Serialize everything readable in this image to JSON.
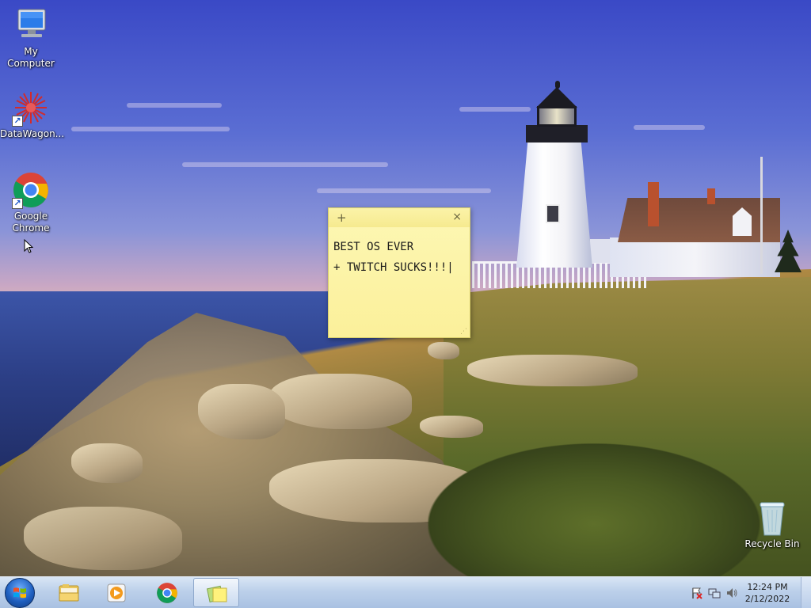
{
  "desktop": {
    "icons": [
      {
        "label": "My Computer",
        "icon": "computer-icon"
      },
      {
        "label": "DataWagon...",
        "icon": "datawagon-icon"
      },
      {
        "label": "Google Chrome",
        "icon": "chrome-icon"
      },
      {
        "label": "Recycle Bin",
        "icon": "recycle-bin-icon"
      }
    ],
    "wallpaper": "lighthouse-coast"
  },
  "sticky_note": {
    "add_glyph": "+",
    "close_glyph": "×",
    "text": "BEST OS EVER\n+ TWITCH SUCKS!!!|"
  },
  "taskbar": {
    "pinned": [
      {
        "name": "windows-explorer",
        "icon": "folder-icon"
      },
      {
        "name": "windows-media-player",
        "icon": "media-player-icon"
      },
      {
        "name": "google-chrome",
        "icon": "chrome-icon"
      },
      {
        "name": "sticky-notes",
        "icon": "sticky-notes-icon",
        "active": true
      }
    ],
    "tray": {
      "icons": [
        "action-center-flag-icon",
        "network-icon",
        "volume-icon"
      ],
      "time": "12:24 PM",
      "date": "2/12/2022"
    }
  },
  "colors": {
    "sticky_bg": "#fdf7b4",
    "taskbar_bg": "#bcd0ea",
    "start_orb": "#1f5fbf"
  }
}
